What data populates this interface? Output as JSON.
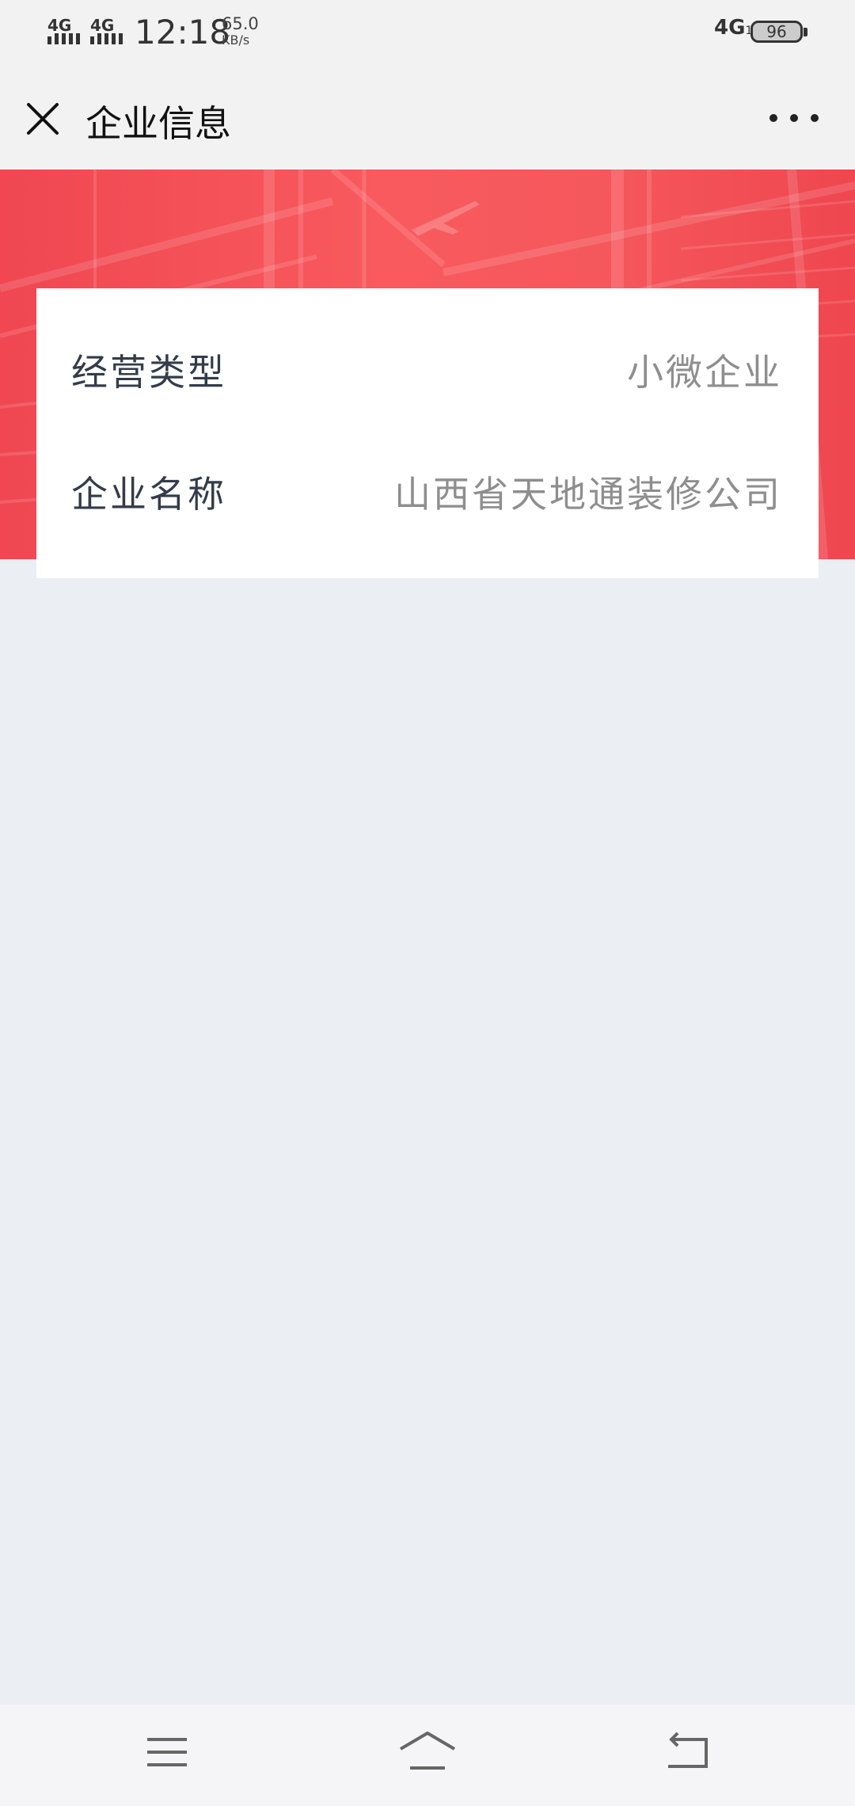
{
  "status_bar": {
    "sim1_network": "4G",
    "sim2_network": "4G",
    "time": "12:18",
    "speed_value": "65.0",
    "speed_unit": "KB/s",
    "right_network": "4G",
    "right_network_sub": "1",
    "battery": "96"
  },
  "navbar": {
    "title": "企业信息",
    "close_icon": "close-icon",
    "more_icon": "more-dots-icon"
  },
  "info": {
    "rows": [
      {
        "label": "经营类型",
        "value": "小微企业"
      },
      {
        "label": "企业名称",
        "value": "山西省天地通装修公司"
      }
    ]
  },
  "system_nav": {
    "menu_icon": "menu-icon",
    "home_icon": "home-icon",
    "back_icon": "back-icon"
  },
  "colors": {
    "banner": "#f5565b",
    "page_background": "#ebeef2",
    "card_background": "#ffffff"
  }
}
